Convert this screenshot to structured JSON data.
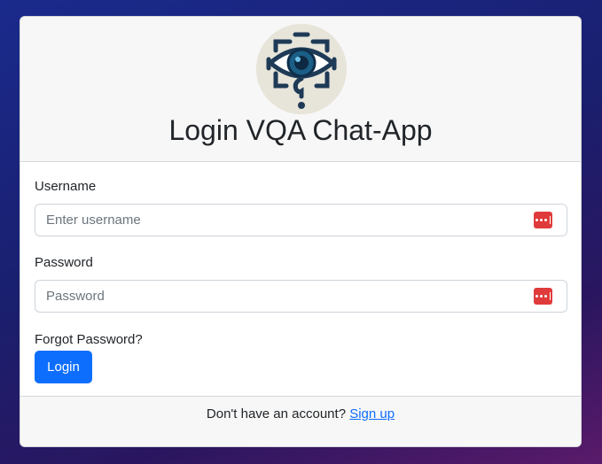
{
  "header": {
    "logo_icon": "eye-question-logo",
    "title": "Login VQA Chat-App"
  },
  "form": {
    "username_label": "Username",
    "username_placeholder": "Enter username",
    "username_value": "",
    "password_label": "Password",
    "password_placeholder": "Password",
    "password_value": "",
    "field_icon": "password-manager-icon",
    "field_icon_color": "#e03b3b",
    "forgot_label": "Forgot Password?",
    "login_label": "Login",
    "login_color": "#0d6efd"
  },
  "footer": {
    "prompt": "Don't have an account?",
    "signup_label": "Sign up"
  }
}
